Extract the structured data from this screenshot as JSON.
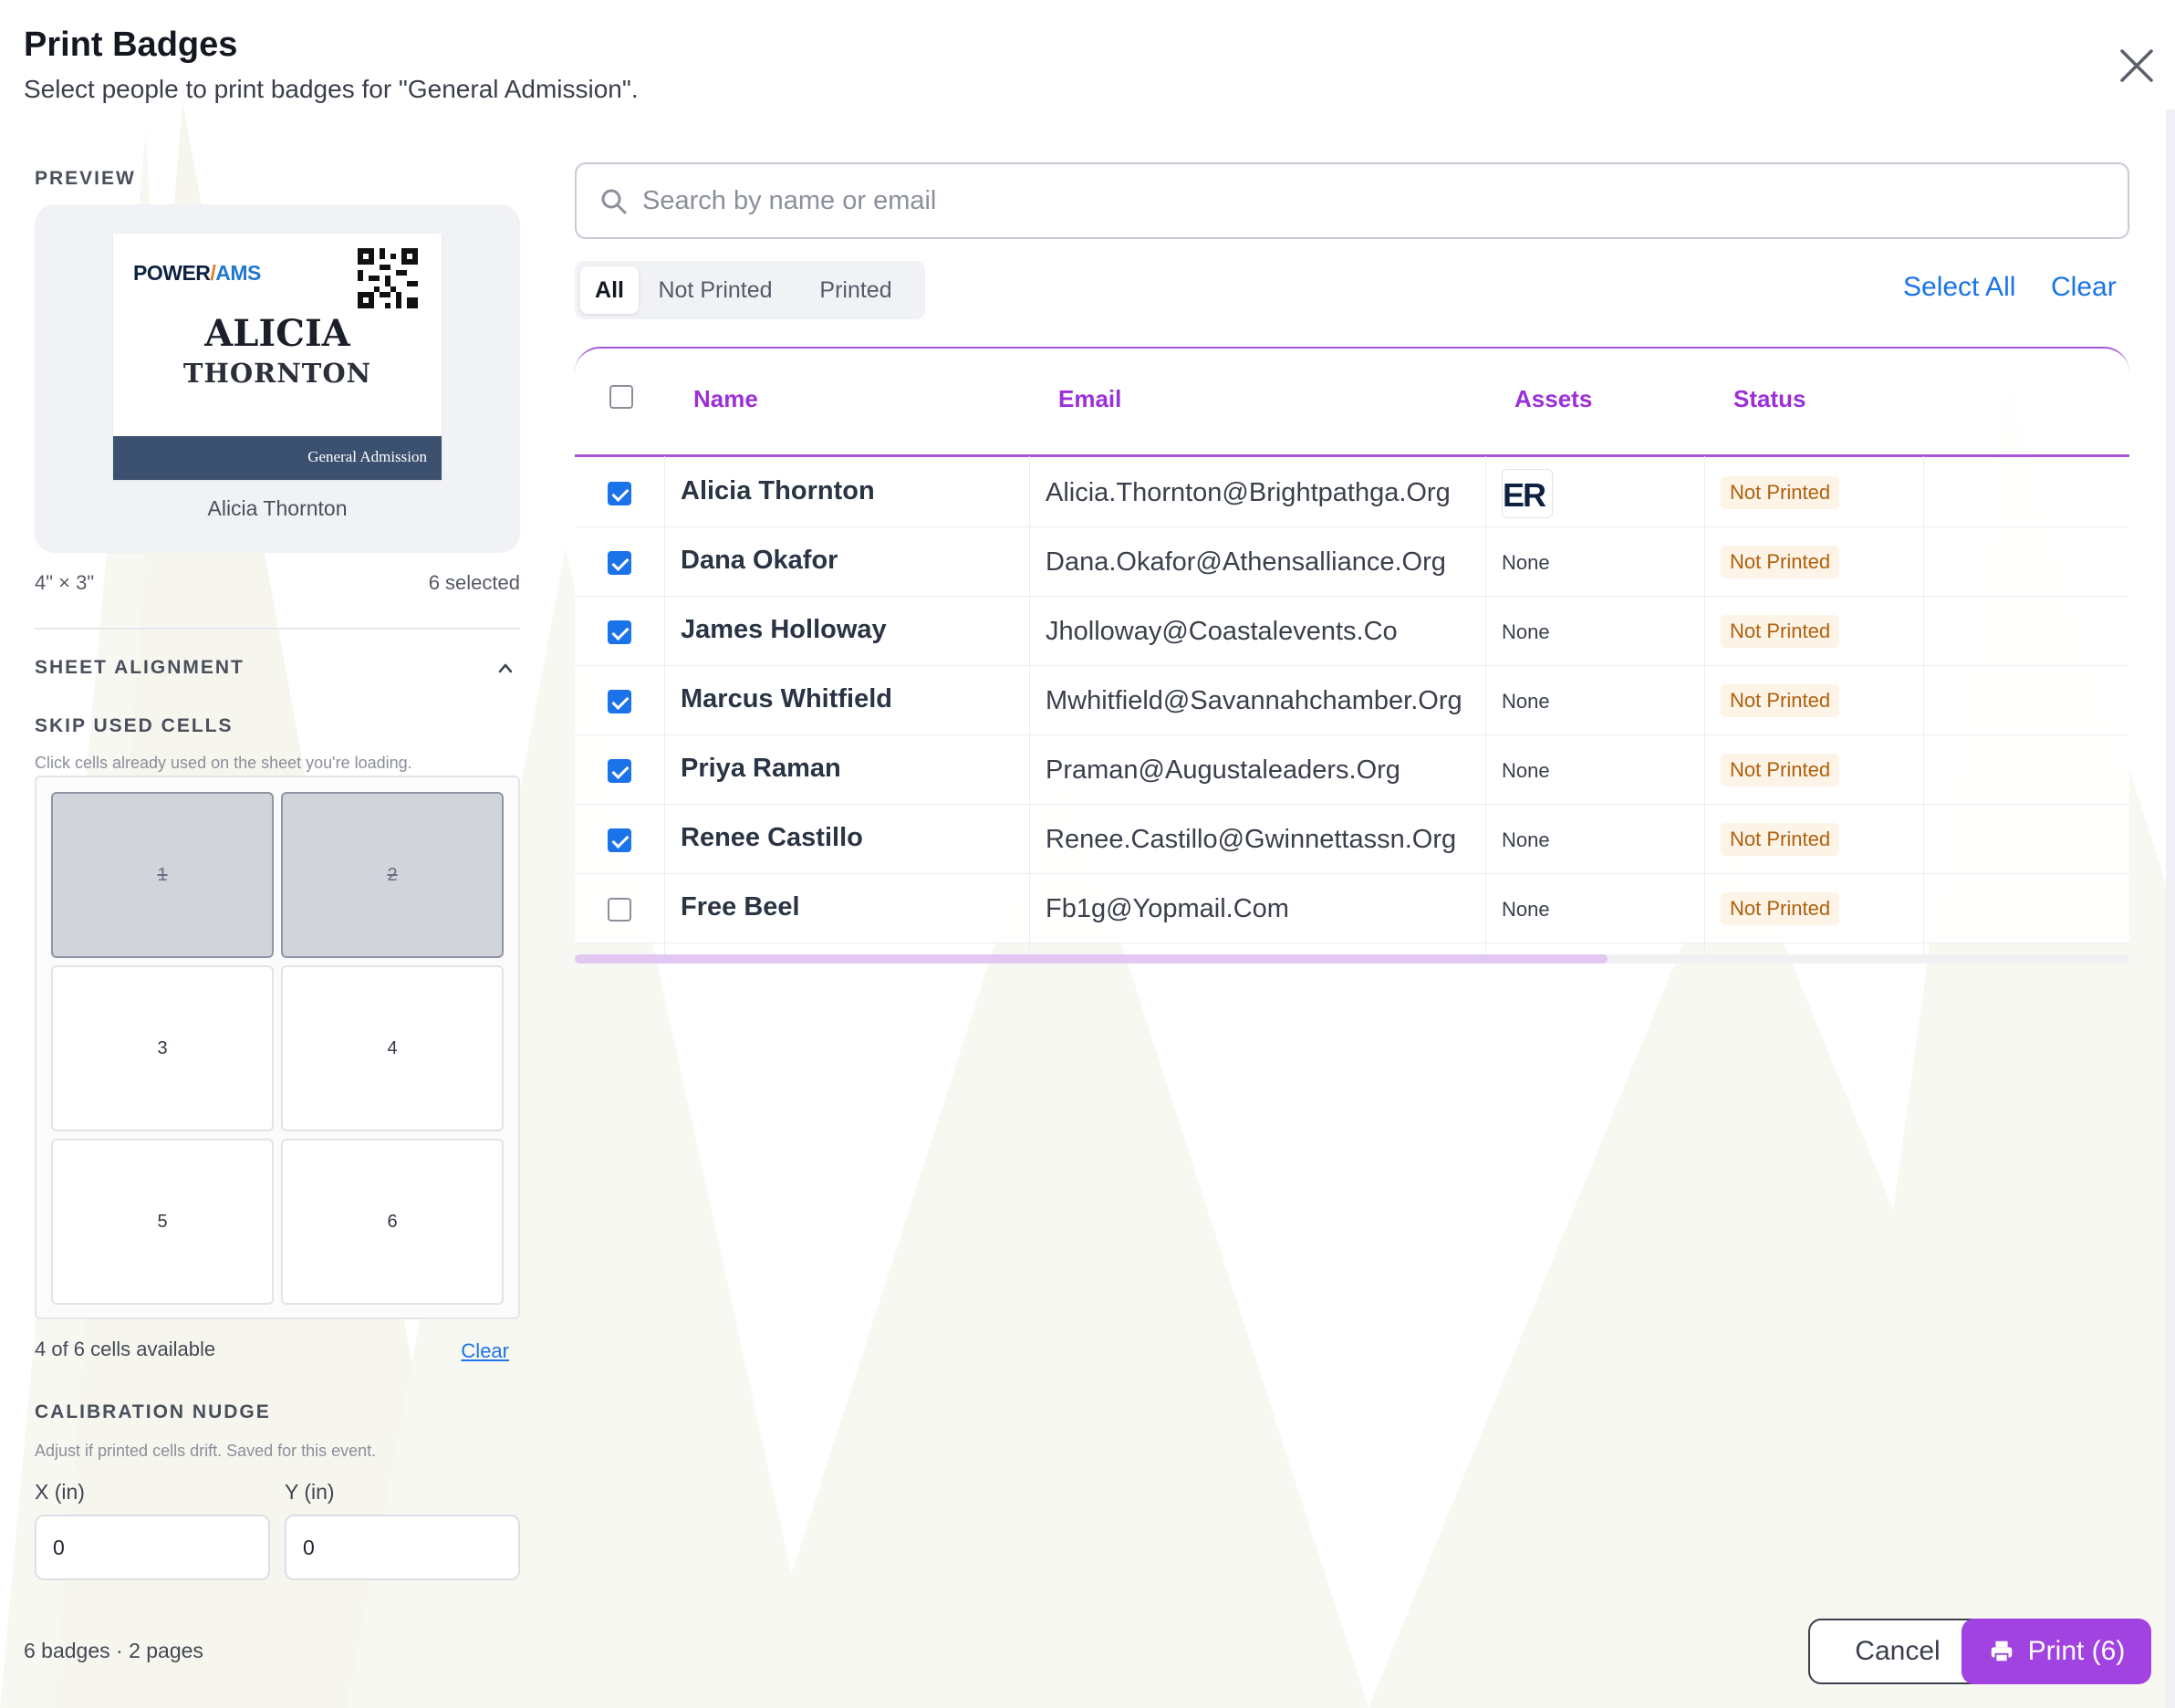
{
  "header": {
    "title": "Print Badges",
    "subtitle": "Select people to print badges for \"General Admission\"."
  },
  "preview": {
    "section_label": "PREVIEW",
    "badge": {
      "logo_power": "POWER",
      "logo_slash": "/",
      "logo_ams": "AMS",
      "first_name": "ALICIA",
      "last_name": "THORNTON",
      "ticket_type": "General Admission"
    },
    "person_name": "Alicia Thornton",
    "dimensions": "4\" × 3\"",
    "selected_count": "6 selected"
  },
  "sheet_alignment": {
    "section_label": "SHEET ALIGNMENT",
    "skip_label": "SKIP USED CELLS",
    "skip_hint": "Click cells already used on the sheet you're loading.",
    "cells": [
      {
        "label": "1",
        "used": true
      },
      {
        "label": "2",
        "used": true
      },
      {
        "label": "3",
        "used": false
      },
      {
        "label": "4",
        "used": false
      },
      {
        "label": "5",
        "used": false
      },
      {
        "label": "6",
        "used": false
      }
    ],
    "available_text": "4 of 6 cells available",
    "clear_label": "Clear"
  },
  "calibration": {
    "section_label": "CALIBRATION NUDGE",
    "hint": "Adjust if printed cells drift. Saved for this event.",
    "x_label": "X (in)",
    "x_value": "0",
    "y_label": "Y (in)",
    "y_value": "0"
  },
  "footer": {
    "summary": "6 badges · 2 pages",
    "cancel_label": "Cancel",
    "print_label": "Print (6)"
  },
  "search": {
    "placeholder": "Search by name or email",
    "value": ""
  },
  "filters": {
    "tabs": [
      {
        "label": "All",
        "active": true
      },
      {
        "label": "Not Printed",
        "active": false
      },
      {
        "label": "Printed",
        "active": false
      }
    ],
    "select_all_label": "Select All",
    "clear_label": "Clear"
  },
  "table": {
    "columns": [
      "Name",
      "Email",
      "Assets",
      "Status"
    ],
    "rows": [
      {
        "checked": true,
        "name": "Alicia Thornton",
        "email": "Alicia.Thornton@Brightpathga.Org",
        "assets": "",
        "has_asset_thumb": true,
        "status": "Not Printed"
      },
      {
        "checked": true,
        "name": "Dana Okafor",
        "email": "Dana.Okafor@Athensalliance.Org",
        "assets": "None",
        "has_asset_thumb": false,
        "status": "Not Printed"
      },
      {
        "checked": true,
        "name": "James Holloway",
        "email": "Jholloway@Coastalevents.Co",
        "assets": "None",
        "has_asset_thumb": false,
        "status": "Not Printed"
      },
      {
        "checked": true,
        "name": "Marcus Whitfield",
        "email": "Mwhitfield@Savannahchamber.Org",
        "assets": "None",
        "has_asset_thumb": false,
        "status": "Not Printed"
      },
      {
        "checked": true,
        "name": "Priya Raman",
        "email": "Praman@Augustaleaders.Org",
        "assets": "None",
        "has_asset_thumb": false,
        "status": "Not Printed"
      },
      {
        "checked": true,
        "name": "Renee Castillo",
        "email": "Renee.Castillo@Gwinnettassn.Org",
        "assets": "None",
        "has_asset_thumb": false,
        "status": "Not Printed"
      },
      {
        "checked": false,
        "name": "Free Beel",
        "email": "Fb1g@Yopmail.Com",
        "assets": "None",
        "has_asset_thumb": false,
        "status": "Not Printed"
      }
    ],
    "asset_thumb_text": "ER"
  },
  "colors": {
    "accent_purple": "#a143e0",
    "link_blue": "#1a73e8",
    "status_orange": "#b0600d",
    "badge_band": "#3c5170"
  },
  "icons": {
    "close": "close-icon",
    "search": "search-icon",
    "chevron": "chevron-up-icon",
    "printer": "printer-icon"
  }
}
